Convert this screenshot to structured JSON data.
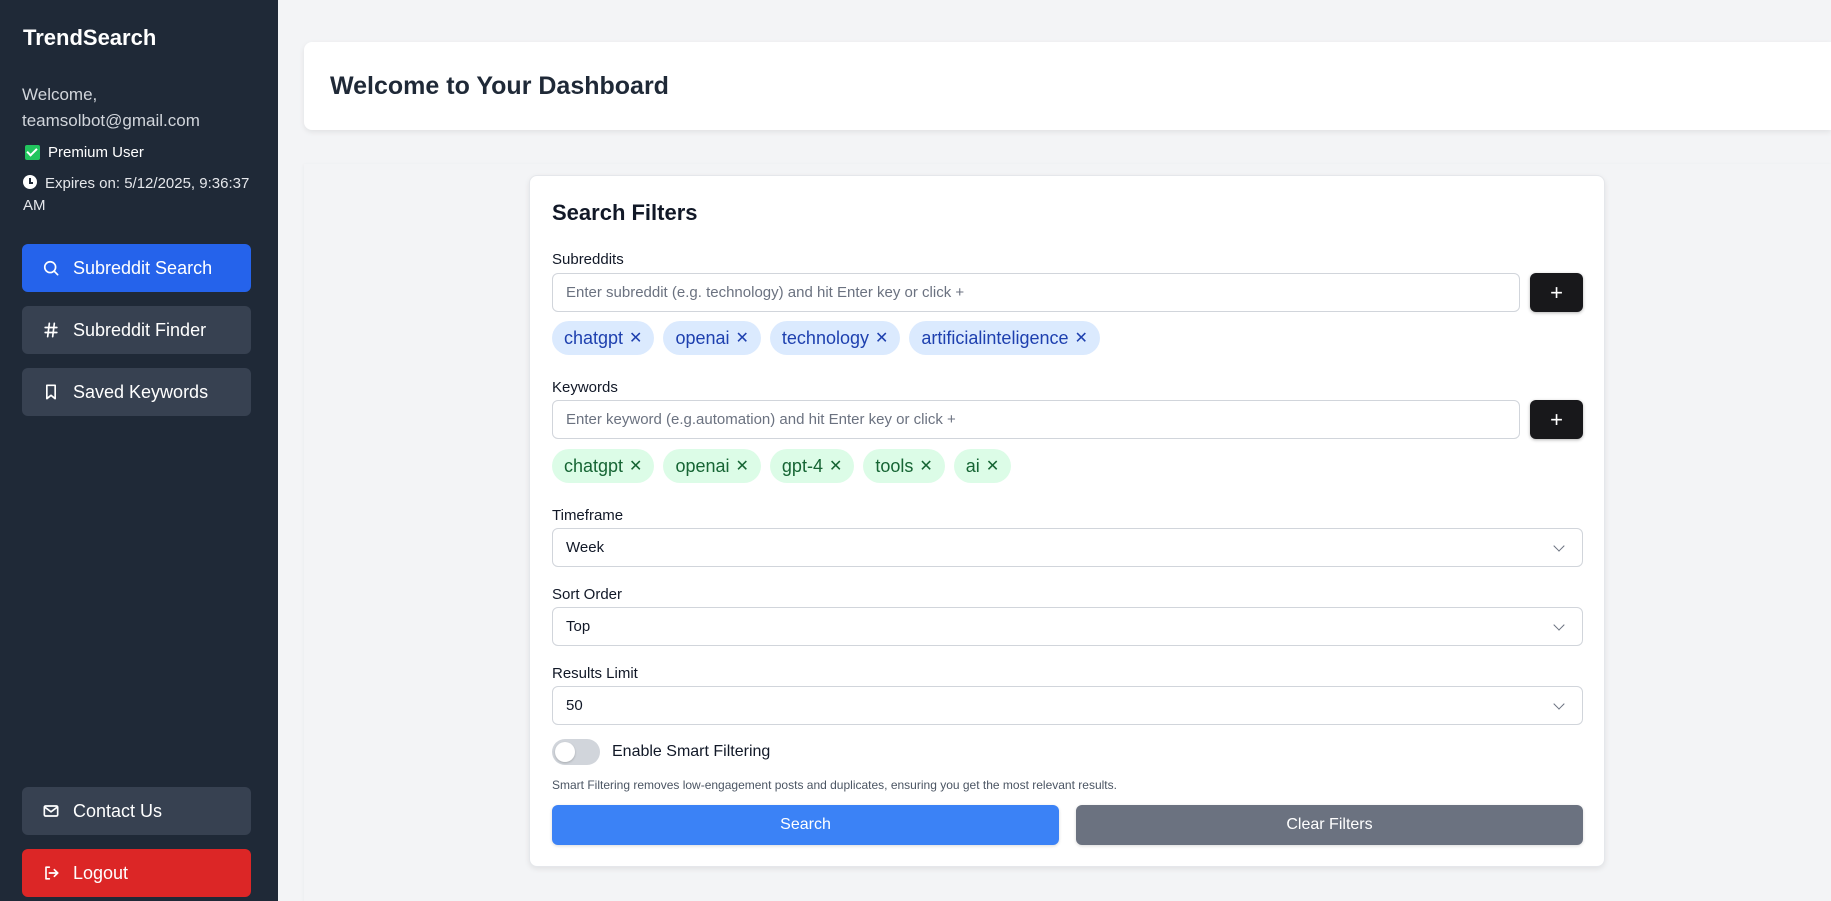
{
  "sidebar": {
    "brand": "TrendSearch",
    "welcome": "Welcome, teamsolbot@gmail.com",
    "premium_label": "Premium User",
    "expires": "Expires on: 5/12/2025, 9:36:37 AM",
    "nav": [
      {
        "label": "Subreddit Search",
        "icon": "search-icon",
        "active": true
      },
      {
        "label": "Subreddit Finder",
        "icon": "hash-icon"
      },
      {
        "label": "Saved Keywords",
        "icon": "bookmark-icon"
      }
    ],
    "contact_label": "Contact Us",
    "logout_label": "Logout"
  },
  "header": {
    "title": "Welcome to Your Dashboard"
  },
  "filters": {
    "title": "Search Filters",
    "subreddits": {
      "label": "Subreddits",
      "placeholder": "Enter subreddit (e.g. technology) and hit Enter key or click +",
      "add_label": "+",
      "chips": [
        "chatgpt",
        "openai",
        "technology",
        "artificialinteligence"
      ]
    },
    "keywords": {
      "label": "Keywords",
      "placeholder": "Enter keyword (e.g.automation) and hit Enter key or click +",
      "add_label": "+",
      "chips": [
        "chatgpt",
        "openai",
        "gpt-4",
        "tools",
        "ai"
      ]
    },
    "timeframe": {
      "label": "Timeframe",
      "value": "Week"
    },
    "sort_order": {
      "label": "Sort Order",
      "value": "Top"
    },
    "results_limit": {
      "label": "Results Limit",
      "value": "50"
    },
    "smart_filtering": {
      "label": "Enable Smart Filtering",
      "enabled": false,
      "helper": "Smart Filtering removes low-engagement posts and duplicates, ensuring you get the most relevant results."
    },
    "search_label": "Search",
    "clear_label": "Clear Filters",
    "chip_remove_glyph": "✕"
  },
  "colors": {
    "sidebar_bg": "#1f2937",
    "active_nav": "#2563eb",
    "logout": "#dc2626",
    "search_btn": "#3b82f6",
    "clear_btn": "#6b7280"
  }
}
